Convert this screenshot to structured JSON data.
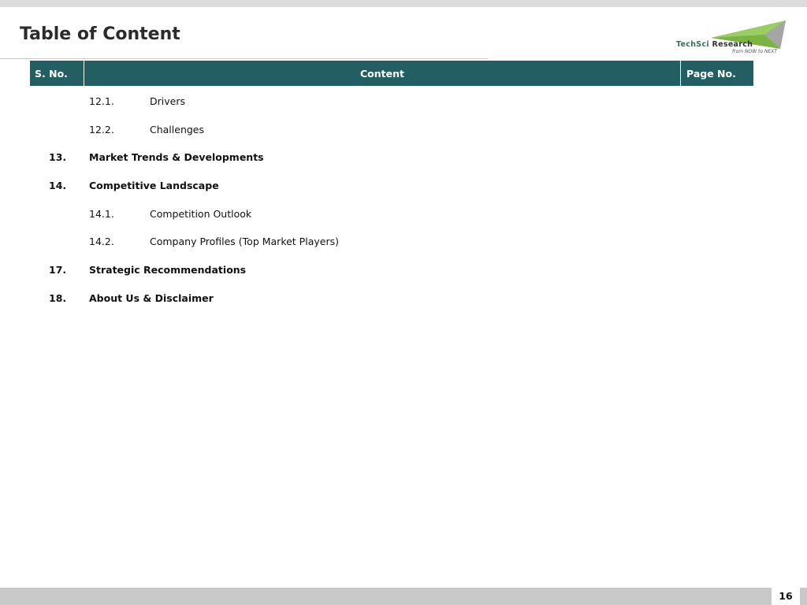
{
  "slide": {
    "title": "Table of Content",
    "page_number": "16"
  },
  "logo": {
    "name_part1": "TechSci",
    "name_part2": "Research",
    "tagline": "from NOW to NEXT"
  },
  "table": {
    "headers": {
      "sno": "S. No.",
      "content": "Content",
      "page": "Page No."
    },
    "rows": [
      {
        "num": "12.1.",
        "label": "Drivers",
        "level": "sub"
      },
      {
        "num": "12.2.",
        "label": "Challenges",
        "level": "sub"
      },
      {
        "num": "13.",
        "label": "Market Trends & Developments",
        "level": "main"
      },
      {
        "num": "14.",
        "label": "Competitive Landscape",
        "level": "main"
      },
      {
        "num": "14.1.",
        "label": "Competition Outlook",
        "level": "sub"
      },
      {
        "num": "14.2.",
        "label": "Company Profiles (Top Market Players)",
        "level": "sub"
      },
      {
        "num": "17.",
        "label": "Strategic Recommendations",
        "level": "main"
      },
      {
        "num": "18.",
        "label": "About Us & Disclaimer",
        "level": "main"
      }
    ]
  },
  "colors": {
    "header_bg": "#235f62",
    "logo_green": "#7cb342",
    "logo_text": "#3d6b5a"
  }
}
